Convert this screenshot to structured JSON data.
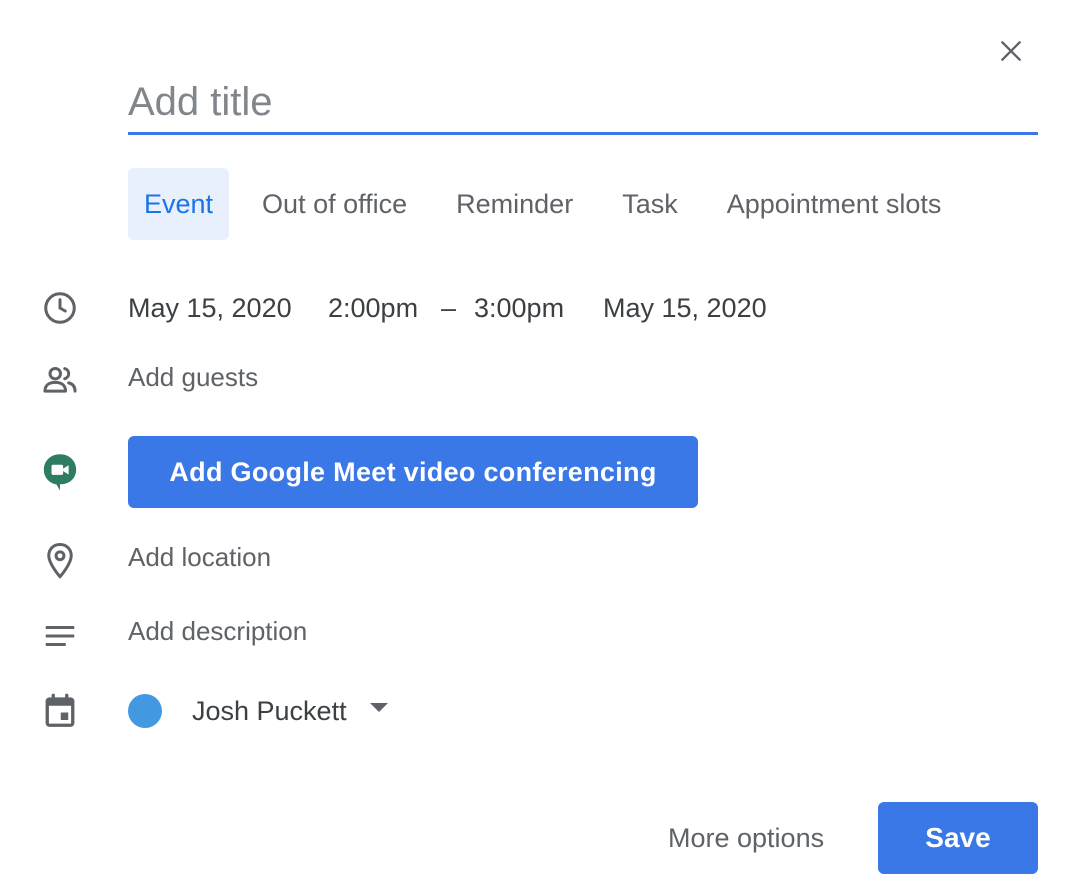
{
  "dialog": {
    "title_placeholder": "Add title",
    "tabs": [
      {
        "label": "Event",
        "active": true
      },
      {
        "label": "Out of office",
        "active": false
      },
      {
        "label": "Reminder",
        "active": false
      },
      {
        "label": "Task",
        "active": false
      },
      {
        "label": "Appointment slots",
        "active": false
      }
    ],
    "datetime": {
      "start_date": "May 15, 2020",
      "start_time": "2:00pm",
      "separator": "–",
      "end_time": "3:00pm",
      "end_date": "May 15, 2020"
    },
    "guests_placeholder": "Add guests",
    "meet_button_label": "Add Google Meet video conferencing",
    "location_placeholder": "Add location",
    "description_placeholder": "Add description",
    "calendar": {
      "owner": "Josh Puckett",
      "color": "#4299e1"
    },
    "footer": {
      "more_options_label": "More options",
      "save_label": "Save"
    }
  },
  "colors": {
    "accent": "#3b78e7",
    "active_tab_bg": "#e8f0fe",
    "meet_green": "#2e7d63"
  },
  "icons": [
    "close-icon",
    "clock-icon",
    "people-icon",
    "google-meet-icon",
    "location-pin-icon",
    "description-icon",
    "calendar-icon",
    "dropdown-caret-icon"
  ]
}
